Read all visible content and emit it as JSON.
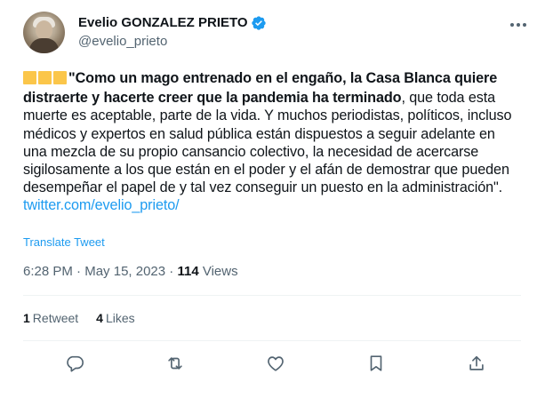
{
  "author": {
    "display_name": "Evelio GONZALEZ PRIETO",
    "handle": "@evelio_prieto",
    "verified": true
  },
  "tweet": {
    "emoji_prefix": "three-yellow-squares",
    "bold_text": "\"Como un mago entrenado en el engaño, la Casa Blanca quiere distraerte y hacerte creer que la pandemia ha terminado",
    "text": ", que toda esta muerte es aceptable, parte de la vida. Y muchos periodistas, políticos, incluso médicos y expertos en salud pública están dispuestos a seguir adelante en una mezcla de su propio cansancio colectivo, la necesidad de acercarse sigilosamente a los que están en el poder y el afán de demostrar que pueden desempeñar el papel de y tal vez conseguir un puesto en la administración\".",
    "link": "twitter.com/evelio_prieto/",
    "translate_label": "Translate Tweet"
  },
  "meta": {
    "time": "6:28 PM",
    "separator": "·",
    "date": "May 15, 2023",
    "views_count": "114",
    "views_label": "Views"
  },
  "stats": {
    "retweets_count": "1",
    "retweets_label": "Retweet",
    "likes_count": "4",
    "likes_label": "Likes"
  },
  "actions": [
    "reply-icon",
    "retweet-icon",
    "like-icon",
    "bookmark-icon",
    "share-icon"
  ],
  "colors": {
    "link": "#1d9bf0",
    "secondary_text": "#536471",
    "primary_text": "#0f1419",
    "emoji_square": "#fbc64a"
  }
}
